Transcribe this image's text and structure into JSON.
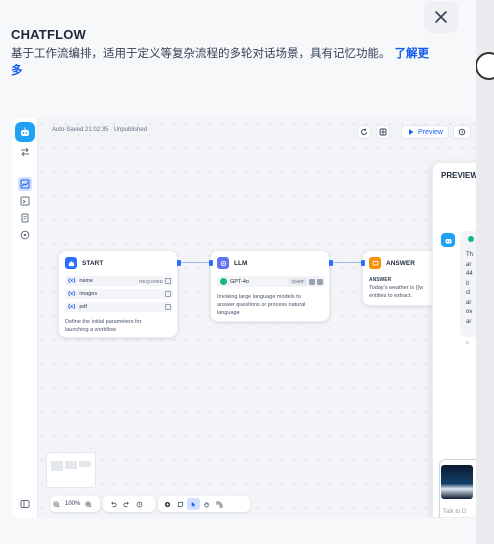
{
  "modal": {
    "title": "CHATFLOW",
    "description": "基于工作流编排，适用于定义等复杂流程的多轮对话场景，具有记忆功能。",
    "learn_more": "了解更多"
  },
  "toolbar": {
    "status": "Auto-Saved 21:02:35 · Unpublished",
    "preview_label": "Preview"
  },
  "nodes": {
    "start": {
      "title": "START",
      "variables": [
        {
          "name": "name",
          "required": "REQUIRED"
        },
        {
          "name": "images",
          "required": ""
        },
        {
          "name": "pdf",
          "required": ""
        }
      ],
      "var_prefix": "{x}",
      "description_line1": "Define the initial parameters for",
      "description_line2": "launching a workflow"
    },
    "llm": {
      "title": "LLM",
      "model": "GPT-4o",
      "mode": "CHAT",
      "description_line1": "Invoking large language models to",
      "description_line2": "answer questions or process natural",
      "description_line3": "language"
    },
    "answer": {
      "title": "ANSWER",
      "field_label": "ANSWER",
      "text_line1": "Today's weather is {{w",
      "text_line2": "entities to extract."
    }
  },
  "preview": {
    "title": "PREVIEW",
    "message_fragment": "Th\nar\n44\nit\ncl\nar\nov\nar",
    "time_fragment": "5.",
    "input_placeholder": "Talk to D"
  },
  "zoom": {
    "level": "100%"
  },
  "icons": {
    "close": "close-icon",
    "app": "robot-icon",
    "start": "home-icon",
    "llm": "brain-icon",
    "answer": "answer-icon"
  },
  "colors": {
    "accent": "#155eef",
    "app_icon": "#1fa2f5",
    "start_icon": "#2970ff",
    "llm_icon": "#6172f3",
    "answer_icon": "#f79009"
  }
}
